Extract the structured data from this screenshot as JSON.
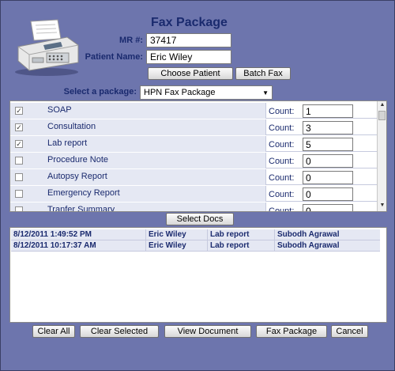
{
  "header": {
    "title": "Fax Package",
    "mr_label": "MR #:",
    "mr_value": "37417",
    "patient_label": "Patient Name:",
    "patient_value": "Eric Wiley"
  },
  "actions_top": {
    "choose_patient": "Choose Patient",
    "batch_fax": "Batch Fax"
  },
  "package": {
    "label": "Select a package:",
    "selected": "HPN Fax Package"
  },
  "documents": {
    "count_label": "Count:",
    "items": [
      {
        "name": "SOAP",
        "checked": true,
        "count": "1"
      },
      {
        "name": "Consultation",
        "checked": true,
        "count": "3"
      },
      {
        "name": "Lab report",
        "checked": true,
        "count": "5"
      },
      {
        "name": "Procedure Note",
        "checked": false,
        "count": "0"
      },
      {
        "name": "Autopsy Report",
        "checked": false,
        "count": "0"
      },
      {
        "name": "Emergency Report",
        "checked": false,
        "count": "0"
      },
      {
        "name": "Tranfer Summary",
        "checked": false,
        "count": "0"
      }
    ]
  },
  "select_docs_label": "Select Docs",
  "selected_docs": [
    {
      "datetime": "8/12/2011 1:49:52 PM",
      "patient": "Eric Wiley",
      "doc": "Lab report",
      "author": "Subodh Agrawal"
    },
    {
      "datetime": "8/12/2011 10:17:37 AM",
      "patient": "Eric Wiley",
      "doc": "Lab report",
      "author": "Subodh Agrawal"
    }
  ],
  "actions_bottom": {
    "clear_all": "Clear All",
    "clear_selected": "Clear Selected",
    "view_document": "View Document",
    "fax_package": "Fax Package",
    "cancel": "Cancel"
  },
  "icons": {
    "fax_machine": "fax-machine-icon",
    "dropdown": "chevron-down-icon",
    "scroll_up": "scroll-up-icon",
    "scroll_down": "scroll-down-icon"
  },
  "colors": {
    "background": "#6d75ad",
    "label_text": "#1a2a6e",
    "row_fill": "#e5e8f3"
  }
}
